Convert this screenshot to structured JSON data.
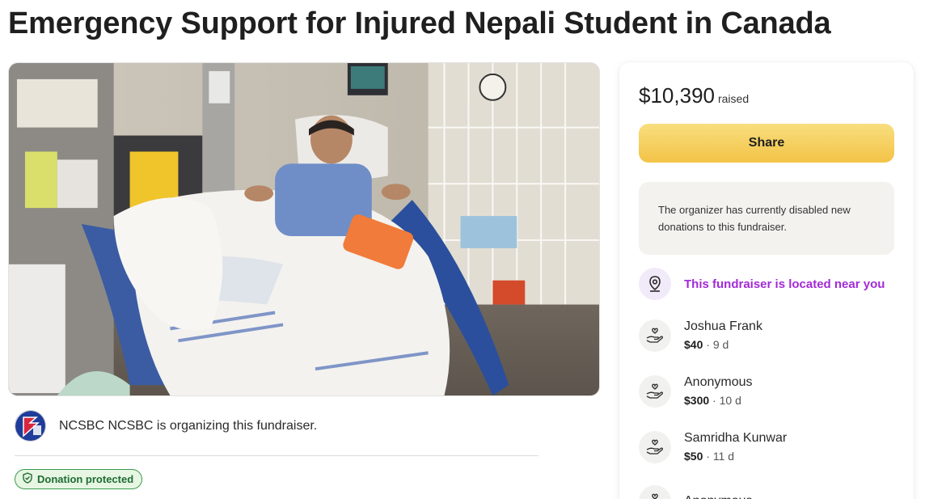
{
  "page": {
    "title": "Emergency Support for Injured Nepali Student in Canada"
  },
  "organizer": {
    "text": "NCSBC NCSBC is organizing this fundraiser.",
    "avatar_icon": "ncsbc-logo-icon"
  },
  "badge": {
    "label": "Donation protected",
    "icon": "shield-check-icon"
  },
  "sidebar": {
    "raised_amount": "$10,390",
    "raised_label": "raised",
    "share_label": "Share",
    "notice": "The organizer has currently disabled new donations to this fundraiser.",
    "location_text": "This fundraiser is located near you",
    "location_icon": "location-pin-icon",
    "donations": [
      {
        "name": "Joshua Frank",
        "amount": "$40",
        "time": "9 d"
      },
      {
        "name": "Anonymous",
        "amount": "$300",
        "time": "10 d"
      },
      {
        "name": "Samridha Kunwar",
        "amount": "$50",
        "time": "11 d"
      },
      {
        "name": "Anonymous",
        "amount": "",
        "time": ""
      }
    ],
    "donation_icon": "heart-hand-icon"
  },
  "colors": {
    "accent_purple": "#a22ad6",
    "share_yellow": "#f3c347",
    "protect_green": "#3a9b50"
  }
}
